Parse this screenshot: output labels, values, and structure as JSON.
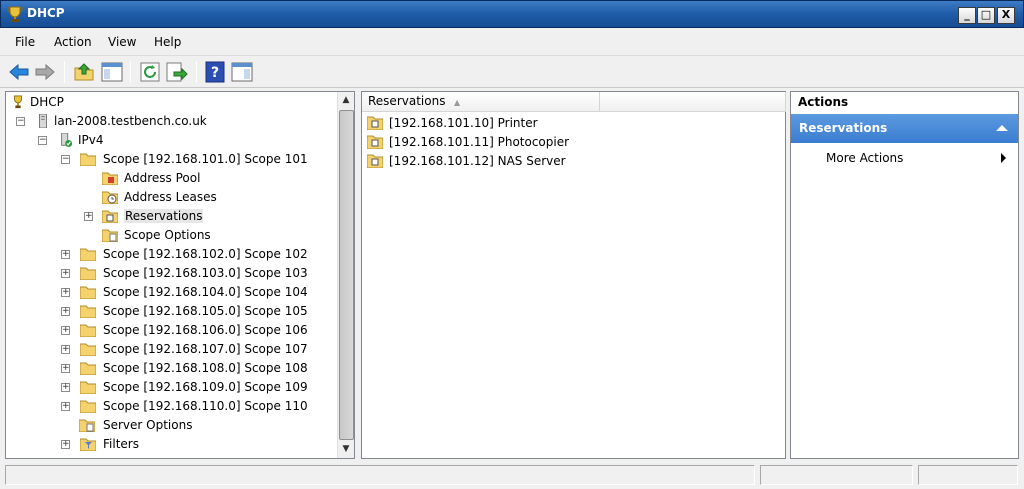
{
  "window": {
    "title": "DHCP",
    "minimize": "_",
    "maximize": "□",
    "close": "X"
  },
  "menu": [
    "File",
    "Action",
    "View",
    "Help"
  ],
  "tree": {
    "root": "DHCP",
    "server": "lan-2008.testbench.co.uk",
    "ipv4": "IPv4",
    "scope_open": "Scope [192.168.101.0] Scope 101",
    "children": [
      "Address Pool",
      "Address Leases",
      "Reservations",
      "Scope Options"
    ],
    "scopes": [
      "Scope [192.168.102.0] Scope 102",
      "Scope [192.168.103.0] Scope 103",
      "Scope [192.168.104.0] Scope 104",
      "Scope [192.168.105.0] Scope 105",
      "Scope [192.168.106.0] Scope 106",
      "Scope [192.168.107.0] Scope 107",
      "Scope [192.168.108.0] Scope 108",
      "Scope [192.168.109.0] Scope 109",
      "Scope [192.168.110.0] Scope 110"
    ],
    "server_options": "Server Options",
    "filters": "Filters"
  },
  "list": {
    "column": "Reservations",
    "rows": [
      "[192.168.101.10] Printer",
      "[192.168.101.11] Photocopier",
      "[192.168.101.12] NAS Server"
    ]
  },
  "actions": {
    "title": "Actions",
    "section": "Reservations",
    "more": "More Actions"
  },
  "colors": {
    "titlebar": "#1f5ca8",
    "actions_section": "#3a7dd0",
    "folder": "#f4d36e"
  }
}
